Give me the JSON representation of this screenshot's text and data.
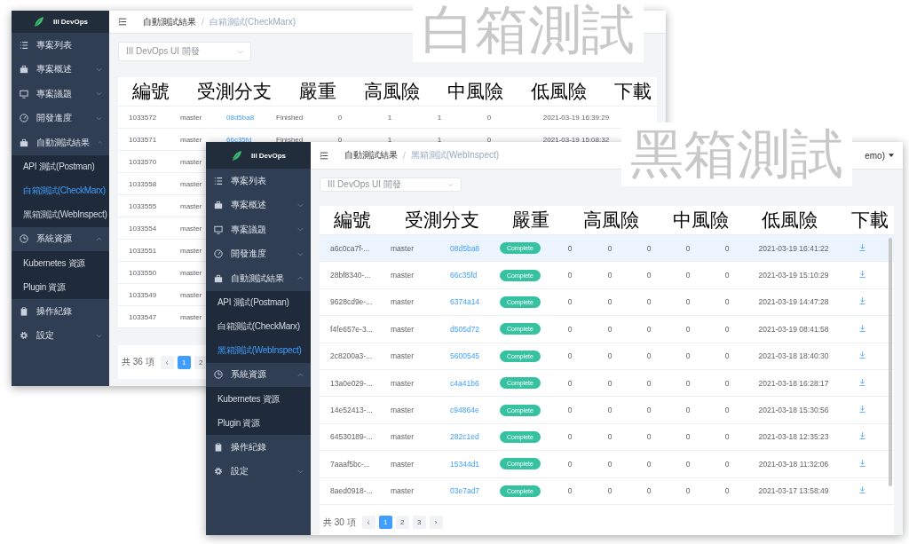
{
  "windows": [
    {
      "kind": "back",
      "sidebar": {
        "brand": "III DevOps",
        "items": [
          {
            "label": "專案列表"
          },
          {
            "label": "專案概述",
            "expanded": false
          },
          {
            "label": "專案議題",
            "expanded": false
          },
          {
            "label": "開發進度",
            "expanded": false
          },
          {
            "label": "自動測試結果",
            "expanded": true,
            "children": [
              {
                "label": "API 測試(Postman)",
                "selected": false
              },
              {
                "label": "白箱測試(CheckMarx)",
                "selected": true
              },
              {
                "label": "黑箱測試(WebInspect)",
                "selected": false
              }
            ]
          },
          {
            "label": "系統資源",
            "expanded": true,
            "children": [
              {
                "label": "Kubernetes 資源",
                "selected": false
              },
              {
                "label": "Plugin 資源",
                "selected": false
              }
            ]
          },
          {
            "label": "操作紀錄"
          },
          {
            "label": "設定",
            "expanded": false
          }
        ]
      },
      "breadcrumb": [
        {
          "label": "自動測試結果",
          "current": false
        },
        {
          "label": "白箱測試(CheckMarx)",
          "current": true
        }
      ],
      "breadcrumb_separator": "/",
      "project_select": "III DevOps UI 開發",
      "column_headers": [
        "編號",
        "受測分支",
        "嚴重",
        "高風險",
        "中風險",
        "低風險",
        "下載"
      ],
      "rows": [
        {
          "id": "1033572",
          "branch": "master",
          "commit": "08d5ba8",
          "status": "Finished",
          "counts": [
            "0",
            "1",
            "1",
            "0"
          ],
          "date": "2021-03-19 16:39:29"
        },
        {
          "id": "1033571",
          "branch": "master",
          "commit": "66c35fd",
          "status": "Finished",
          "counts": [
            "0",
            "1",
            "1",
            "0"
          ],
          "date": "2021-03-19 15:08:32"
        },
        {
          "id": "1033570",
          "branch": "master"
        },
        {
          "id": "1033558",
          "branch": "master"
        },
        {
          "id": "1033555",
          "branch": "master"
        },
        {
          "id": "1033554",
          "branch": "master"
        },
        {
          "id": "1033551",
          "branch": "master"
        },
        {
          "id": "1033550",
          "branch": "master"
        },
        {
          "id": "1033549",
          "branch": "master"
        },
        {
          "id": "1033547",
          "branch": "master"
        }
      ],
      "pagination": {
        "total": "共 36 項",
        "buttons": [
          {
            "label": "‹",
            "selected": false,
            "disabled": true
          },
          {
            "label": "1",
            "selected": true,
            "disabled": false
          },
          {
            "label": "2",
            "selected": false,
            "disabled": false
          }
        ]
      }
    },
    {
      "kind": "front",
      "user_menu": "emo)",
      "sidebar": {
        "brand": "III DevOps",
        "items": [
          {
            "label": "專案列表"
          },
          {
            "label": "專案概述",
            "expanded": false
          },
          {
            "label": "專案議題",
            "expanded": false
          },
          {
            "label": "開發進度",
            "expanded": false
          },
          {
            "label": "自動測試結果",
            "expanded": true,
            "children": [
              {
                "label": "API 測試(Postman)",
                "selected": false
              },
              {
                "label": "白箱測試(CheckMarx)",
                "selected": false
              },
              {
                "label": "黑箱測試(WebInspect)",
                "selected": true
              }
            ]
          },
          {
            "label": "系統資源",
            "expanded": true,
            "children": [
              {
                "label": "Kubernetes 資源",
                "selected": false
              },
              {
                "label": "Plugin 資源",
                "selected": false
              }
            ]
          },
          {
            "label": "操作紀錄"
          },
          {
            "label": "設定",
            "expanded": false
          }
        ]
      },
      "breadcrumb": [
        {
          "label": "自動測試結果",
          "current": false
        },
        {
          "label": "黑箱測試(WebInspect)",
          "current": true
        }
      ],
      "breadcrumb_separator": "/",
      "project_select": "III DevOps UI 開發",
      "column_headers": [
        "編號",
        "受測分支",
        "嚴重",
        "高風險",
        "中風險",
        "低風險",
        "下載"
      ],
      "rows": [
        {
          "id": "a6c0ca7f-...",
          "branch": "master",
          "commit": "08d5ba8",
          "status": "Complete",
          "counts": [
            "0",
            "0",
            "0",
            "0",
            "0"
          ],
          "date": "2021-03-19 16:41:22",
          "downloadable": true,
          "selected": true
        },
        {
          "id": "28bf8340-...",
          "branch": "master",
          "commit": "66c35fd",
          "status": "Complete",
          "counts": [
            "0",
            "0",
            "0",
            "0",
            "0"
          ],
          "date": "2021-03-19 15:10:29",
          "downloadable": true,
          "selected": false
        },
        {
          "id": "9628cd9e-...",
          "branch": "master",
          "commit": "6374a14",
          "status": "Complete",
          "counts": [
            "0",
            "0",
            "0",
            "0",
            "0"
          ],
          "date": "2021-03-19 14:47:28",
          "downloadable": true,
          "selected": false
        },
        {
          "id": "f4fe657e-3...",
          "branch": "master",
          "commit": "d505d72",
          "status": "Complete",
          "counts": [
            "0",
            "0",
            "0",
            "0",
            "0"
          ],
          "date": "2021-03-19 08:41:58",
          "downloadable": true,
          "selected": false
        },
        {
          "id": "2c8200a3-...",
          "branch": "master",
          "commit": "5600545",
          "status": "Complete",
          "counts": [
            "0",
            "0",
            "0",
            "0",
            "0"
          ],
          "date": "2021-03-18 18:40:30",
          "downloadable": true,
          "selected": false
        },
        {
          "id": "13a0e029-...",
          "branch": "master",
          "commit": "c4a41b6",
          "status": "Complete",
          "counts": [
            "0",
            "0",
            "0",
            "0",
            "0"
          ],
          "date": "2021-03-18 16:28:17",
          "downloadable": true,
          "selected": false
        },
        {
          "id": "14e52413-...",
          "branch": "master",
          "commit": "c94864e",
          "status": "Complete",
          "counts": [
            "0",
            "0",
            "0",
            "0",
            "0"
          ],
          "date": "2021-03-18 15:30:56",
          "downloadable": true,
          "selected": false
        },
        {
          "id": "64530189-...",
          "branch": "master",
          "commit": "282c1ed",
          "status": "Complete",
          "counts": [
            "0",
            "0",
            "0",
            "0",
            "0"
          ],
          "date": "2021-03-18 12:35:23",
          "downloadable": true,
          "selected": false
        },
        {
          "id": "7aaaf5bc-...",
          "branch": "master",
          "commit": "15344d1",
          "status": "Complete",
          "counts": [
            "0",
            "0",
            "0",
            "0",
            "0"
          ],
          "date": "2021-03-18 11:32:06",
          "downloadable": true,
          "selected": false
        },
        {
          "id": "8aed0918-...",
          "branch": "master",
          "commit": "03e7ad7",
          "status": "Complete",
          "counts": [
            "0",
            "0",
            "0",
            "0",
            "0"
          ],
          "date": "2021-03-17 13:58:49",
          "downloadable": true,
          "selected": false
        }
      ],
      "pagination": {
        "total": "共 30 項",
        "buttons": [
          {
            "label": "‹",
            "selected": false,
            "disabled": true
          },
          {
            "label": "1",
            "selected": true,
            "disabled": false
          },
          {
            "label": "2",
            "selected": false,
            "disabled": false
          },
          {
            "label": "3",
            "selected": false,
            "disabled": false
          },
          {
            "label": "›",
            "selected": false,
            "disabled": false
          }
        ]
      }
    }
  ],
  "captions": [
    "白箱測試",
    "黑箱測試"
  ]
}
